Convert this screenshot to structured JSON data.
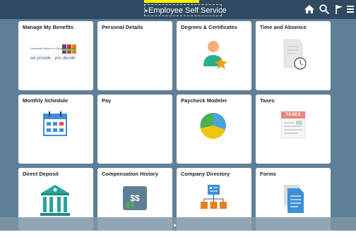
{
  "header": {
    "title": "Employee Self Service",
    "icons": [
      "home-icon",
      "search-icon",
      "flag-icon",
      "menu-icon"
    ]
  },
  "tiles": [
    {
      "label": "Manage My Benefits",
      "icon": "benefits-logo",
      "logo_text": "University System of Georgia Benefits",
      "tagline": "we provide · you decide"
    },
    {
      "label": "Personal Details",
      "icon": "none"
    },
    {
      "label": "Degrees & Certificates",
      "icon": "person-star-icon"
    },
    {
      "label": "Time and Absence",
      "icon": "document-clock-icon"
    },
    {
      "label": "Monthly Schedule",
      "icon": "calendar-icon"
    },
    {
      "label": "Pay",
      "icon": "none"
    },
    {
      "label": "Paycheck Modeler",
      "icon": "pie-chart-icon"
    },
    {
      "label": "Taxes",
      "icon": "taxes-document-icon",
      "badge": "TAXES"
    },
    {
      "label": "Direct Deposit",
      "icon": "bank-icon"
    },
    {
      "label": "Compensation History",
      "icon": "money-icon",
      "money_text": "$$"
    },
    {
      "label": "Company Directory",
      "icon": "org-chart-icon"
    },
    {
      "label": "Forms",
      "icon": "forms-icon"
    }
  ],
  "colors": {
    "topbar": "#2f4a61",
    "background": "#5f7f96",
    "highlight": "#fff200"
  }
}
